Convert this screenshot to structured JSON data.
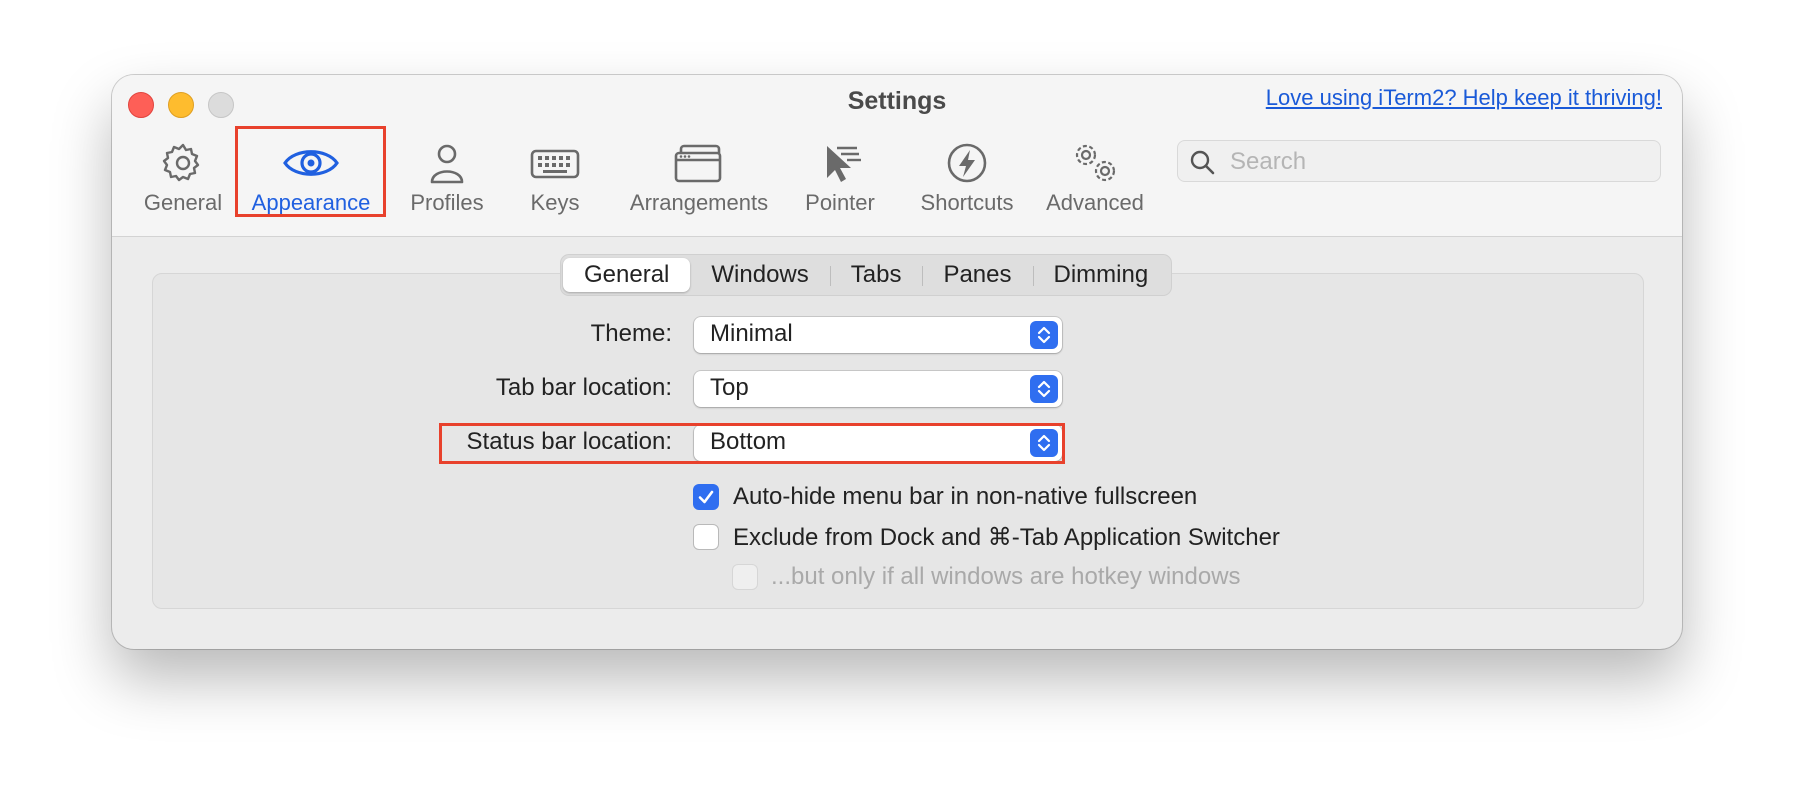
{
  "window": {
    "title": "Settings",
    "donate_link": "Love using iTerm2? Help keep it thriving!"
  },
  "toolbar": {
    "items": [
      {
        "label": "General",
        "icon": "gear-icon"
      },
      {
        "label": "Appearance",
        "icon": "eye-icon",
        "selected": true
      },
      {
        "label": "Profiles",
        "icon": "person-icon"
      },
      {
        "label": "Keys",
        "icon": "keyboard-icon"
      },
      {
        "label": "Arrangements",
        "icon": "windows-icon"
      },
      {
        "label": "Pointer",
        "icon": "pointer-icon"
      },
      {
        "label": "Shortcuts",
        "icon": "lightning-icon"
      },
      {
        "label": "Advanced",
        "icon": "gears-icon"
      }
    ],
    "search_placeholder": "Search"
  },
  "tabs": {
    "items": [
      "General",
      "Windows",
      "Tabs",
      "Panes",
      "Dimming"
    ],
    "selected": "General"
  },
  "form": {
    "theme_label": "Theme:",
    "theme_value": "Minimal",
    "tabbar_label": "Tab bar location:",
    "tabbar_value": "Top",
    "statusbar_label": "Status bar location:",
    "statusbar_value": "Bottom",
    "autohide_label": "Auto-hide menu bar in non-native fullscreen",
    "autohide_checked": true,
    "exclude_label": "Exclude from Dock and ⌘-Tab Application Switcher",
    "exclude_checked": false,
    "hotkey_label": "...but only if all windows are hotkey windows",
    "hotkey_checked": false
  },
  "colors": {
    "accent": "#2f6ef0",
    "highlight": "#e8412c",
    "close": "#fe5f57",
    "minimize": "#febc2e"
  }
}
